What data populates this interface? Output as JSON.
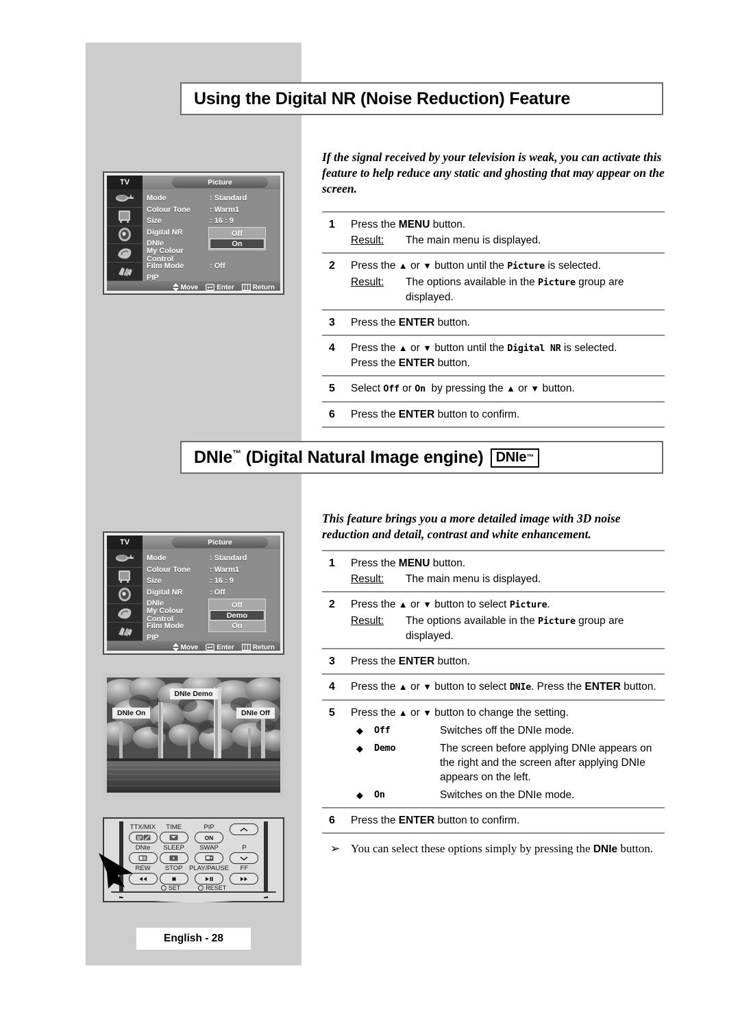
{
  "page": {
    "footer_label": "English - 28",
    "background": "#ffffff",
    "panel_color": "#cdcdcd"
  },
  "section1": {
    "heading": "Using the Digital NR (Noise Reduction) Feature",
    "intro": "If the signal received by your television is weak, you can activate this feature to help reduce any static and ghosting that may appear on the screen.",
    "steps": [
      {
        "num": "1",
        "lines": [
          "Press the MENU button."
        ],
        "result_label": "Result:",
        "result": "The main menu is displayed."
      },
      {
        "num": "2",
        "lines": [
          "Press the ▲ or ▼ button until the Picture is selected."
        ],
        "result_label": "Result:",
        "result": "The options available in the Picture group are displayed."
      },
      {
        "num": "3",
        "lines": [
          "Press the ENTER button."
        ]
      },
      {
        "num": "4",
        "lines": [
          "Press the ▲ or ▼ button until the Digital NR is selected.",
          "Press the ENTER button."
        ]
      },
      {
        "num": "5",
        "lines": [
          "Select Off or On  by pressing the ▲ or ▼ button."
        ]
      },
      {
        "num": "6",
        "lines": [
          "Press the ENTER button to confirm."
        ]
      }
    ]
  },
  "section2": {
    "heading": "DNIe™ (Digital Natural Image engine)",
    "badge": "DNIe",
    "badge_tm": "™",
    "intro": "This feature brings you a more detailed image with 3D noise reduction and detail, contrast and white enhancement.",
    "steps": [
      {
        "num": "1",
        "lines": [
          "Press the MENU button."
        ],
        "result_label": "Result:",
        "result": "The main menu is displayed."
      },
      {
        "num": "2",
        "lines": [
          "Press the ▲ or ▼ button to select Picture."
        ],
        "result_label": "Result:",
        "result": "The options available in the Picture group are displayed."
      },
      {
        "num": "3",
        "lines": [
          "Press the ENTER button."
        ]
      },
      {
        "num": "4",
        "lines": [
          "Press the ▲ or ▼ button to select DNIe. Press the ENTER button."
        ]
      },
      {
        "num": "5",
        "lines": [
          "Press the ▲ or ▼ button to change the setting."
        ],
        "options": [
          {
            "bullet": "◆",
            "name": "Off",
            "desc": "Switches off the DNIe mode."
          },
          {
            "bullet": "◆",
            "name": "Demo",
            "desc": "The screen before applying DNIe appears on the right and the screen after applying DNIe appears on the left."
          },
          {
            "bullet": "◆",
            "name": "On",
            "desc": "Switches on the DNIe mode."
          }
        ]
      },
      {
        "num": "6",
        "lines": [
          "Press the ENTER button to confirm."
        ]
      }
    ],
    "note": {
      "bullet": "➢",
      "text_before": "You can select these options simply by pressing the ",
      "text_bold": "DNIe",
      "text_after": " button."
    }
  },
  "osd_menu_1": {
    "tv_label": "TV",
    "tab_label": "Picture",
    "rows": [
      {
        "label": "Mode",
        "value": ": Standard"
      },
      {
        "label": "Colour Tone",
        "value": ": Warm1"
      },
      {
        "label": "Size",
        "value": ": 16 : 9"
      },
      {
        "label": "Digital NR",
        "value": ":"
      },
      {
        "label": "DNIe",
        "value": ":"
      },
      {
        "label": "My Colour Control",
        "value": ""
      },
      {
        "label": "Film Mode",
        "value": ": Off"
      },
      {
        "label": "PIP",
        "value": ""
      }
    ],
    "popup": {
      "items": [
        "Off",
        "On"
      ],
      "selected": "On"
    },
    "footer": [
      {
        "icon": "up-down-arrow-icon",
        "label": "Move"
      },
      {
        "icon": "enter-key-icon",
        "label": "Enter"
      },
      {
        "icon": "return-menu-icon",
        "label": "Return"
      }
    ]
  },
  "osd_menu_2": {
    "tv_label": "TV",
    "tab_label": "Picture",
    "rows": [
      {
        "label": "Mode",
        "value": ": Standard"
      },
      {
        "label": "Colour Tone",
        "value": ": Warm1"
      },
      {
        "label": "Size",
        "value": ": 16 : 9"
      },
      {
        "label": "Digital NR",
        "value": ": Off"
      },
      {
        "label": "DNIe",
        "value": ":"
      },
      {
        "label": "My Colour Control",
        "value": ""
      },
      {
        "label": "Film Mode",
        "value": ":"
      },
      {
        "label": "PIP",
        "value": ""
      }
    ],
    "popup": {
      "items": [
        "Off",
        "Demo",
        "On"
      ],
      "selected": "Demo"
    },
    "footer": [
      {
        "icon": "up-down-arrow-icon",
        "label": "Move"
      },
      {
        "icon": "enter-key-icon",
        "label": "Enter"
      },
      {
        "icon": "return-menu-icon",
        "label": "Return"
      }
    ]
  },
  "demo_photo": {
    "label_top": "DNIe Demo",
    "label_left": "DNIe On",
    "label_right": "DNIe Off"
  },
  "remote": {
    "buttons": [
      {
        "cap": "TTX/MIX",
        "glyph": "ttx-mix-icon"
      },
      {
        "cap": "TIME",
        "glyph": "time-icon"
      },
      {
        "cap": "PIP",
        "glyph": "ON"
      },
      {
        "cap": "",
        "glyph": "chevron-up-icon"
      },
      {
        "cap": "DNIe",
        "glyph": "dnie-icon"
      },
      {
        "cap": "SLEEP",
        "glyph": "sleep-icon"
      },
      {
        "cap": "SWAP",
        "glyph": "swap-icon"
      },
      {
        "cap": "P",
        "glyph": "chevron-down-icon"
      },
      {
        "cap": "REW",
        "glyph": "◀◀"
      },
      {
        "cap": "STOP",
        "glyph": "■"
      },
      {
        "cap": "PLAY/PAUSE",
        "glyph": "▶❙"
      },
      {
        "cap": "FF",
        "glyph": "▶▶"
      }
    ],
    "set_label": "SET",
    "reset_label": "RESET"
  }
}
